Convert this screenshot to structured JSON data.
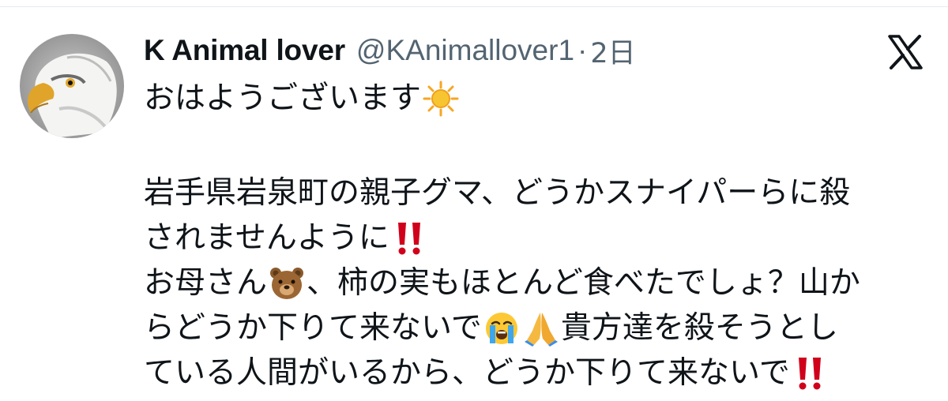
{
  "tweet": {
    "author": {
      "display_name": "K Animal lover",
      "handle": "@KAnimallover1",
      "separator": "·",
      "timestamp": "2日"
    },
    "platform_icon": "x-logo-icon",
    "body_lines": {
      "l1": "おはようございます",
      "l1_emoji": "sun-emoji",
      "l3": "岩手県岩泉町の親子グマ、どうかスナイパーらに殺",
      "l4": "されませんように",
      "l4_emoji": "double-exclamation-emoji",
      "l5a": "お母さん",
      "l5_emoji": "bear-face-emoji",
      "l5b": "、柿の実もほとんど食べたでしょ？山か",
      "l6a": "らどうか下りて来ないで",
      "l6_emoji1": "loudly-crying-face-emoji",
      "l6_emoji2": "folded-hands-emoji",
      "l6b": "貴方達を殺そうとし",
      "l7": "ている人間がいるから、どうか下りて来ないで",
      "l7_emoji": "double-exclamation-emoji"
    },
    "colors": {
      "text": "#0f1419",
      "secondary": "#536471",
      "exclamation": "#d0021b"
    }
  }
}
